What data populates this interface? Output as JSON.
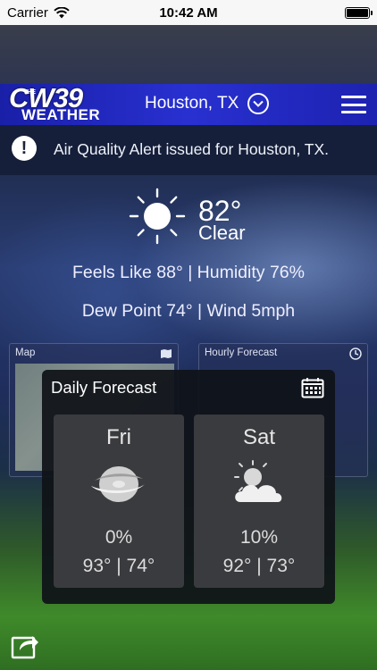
{
  "status_bar": {
    "carrier": "Carrier",
    "time": "10:42 AM"
  },
  "header": {
    "logo_the": "THE",
    "logo_cw": "CW39",
    "logo_weather": "WEATHER",
    "location": "Houston, TX"
  },
  "alert": {
    "text": "Air Quality Alert issued for Houston, TX."
  },
  "current": {
    "temperature": "82°",
    "condition": "Clear",
    "feels_like_line": "Feels Like 88° | Humidity 76%",
    "dew_wind_line": "Dew Point 74° | Wind  5mph",
    "icon": "sun-icon"
  },
  "background_cards": {
    "map_title": "Map",
    "hourly_title": "Hourly Forecast"
  },
  "daily": {
    "title": "Daily Forecast",
    "days": [
      {
        "name": "Fri",
        "precip": "0%",
        "temps": "93° | 74°",
        "icon": "hurricane-icon"
      },
      {
        "name": "Sat",
        "precip": "10%",
        "temps": "92° | 73°",
        "icon": "partly-cloudy-icon"
      }
    ]
  },
  "colors": {
    "header_blue": "#2830d0",
    "panel_dark": "#0f1218",
    "day_card": "#3a3b3e"
  }
}
